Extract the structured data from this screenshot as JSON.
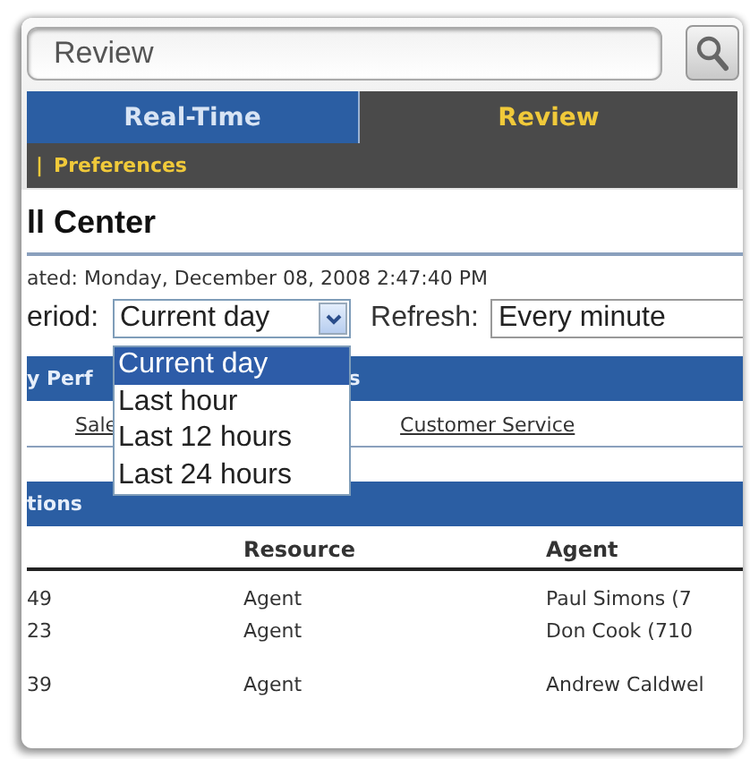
{
  "search": {
    "value": "Review"
  },
  "tabs": [
    {
      "label": "Real-Time",
      "selected": false
    },
    {
      "label": "Review",
      "selected": true
    }
  ],
  "subnav": {
    "separator": "|",
    "link": "Preferences"
  },
  "title": "ll Center",
  "updated": "ated: Monday, December 08, 2008 2:47:40 PM",
  "period": {
    "label": "eriod:",
    "value": "Current day",
    "expanded": true,
    "options": [
      {
        "label": "Current day",
        "selected": true
      },
      {
        "label": "Last hour",
        "selected": false
      },
      {
        "label": "Last 12 hours",
        "selected": false
      },
      {
        "label": "Last 24 hours",
        "selected": false
      }
    ]
  },
  "refresh": {
    "label": "Refresh:",
    "value": "Every minute"
  },
  "performance": {
    "heading_parts": [
      "y Perf",
      "s"
    ],
    "links": [
      "Sale",
      "Customer Service"
    ]
  },
  "table": {
    "heading": "tions",
    "columns": [
      "",
      "Resource",
      "Agent"
    ],
    "rows": [
      {
        "cells": [
          "49",
          "Agent",
          "Paul Simons (7"
        ]
      },
      {
        "cells": [
          "23",
          "Agent",
          "Don Cook (710"
        ]
      },
      {
        "cells": [
          "39",
          "Agent",
          "Andrew Caldwel"
        ]
      }
    ]
  }
}
